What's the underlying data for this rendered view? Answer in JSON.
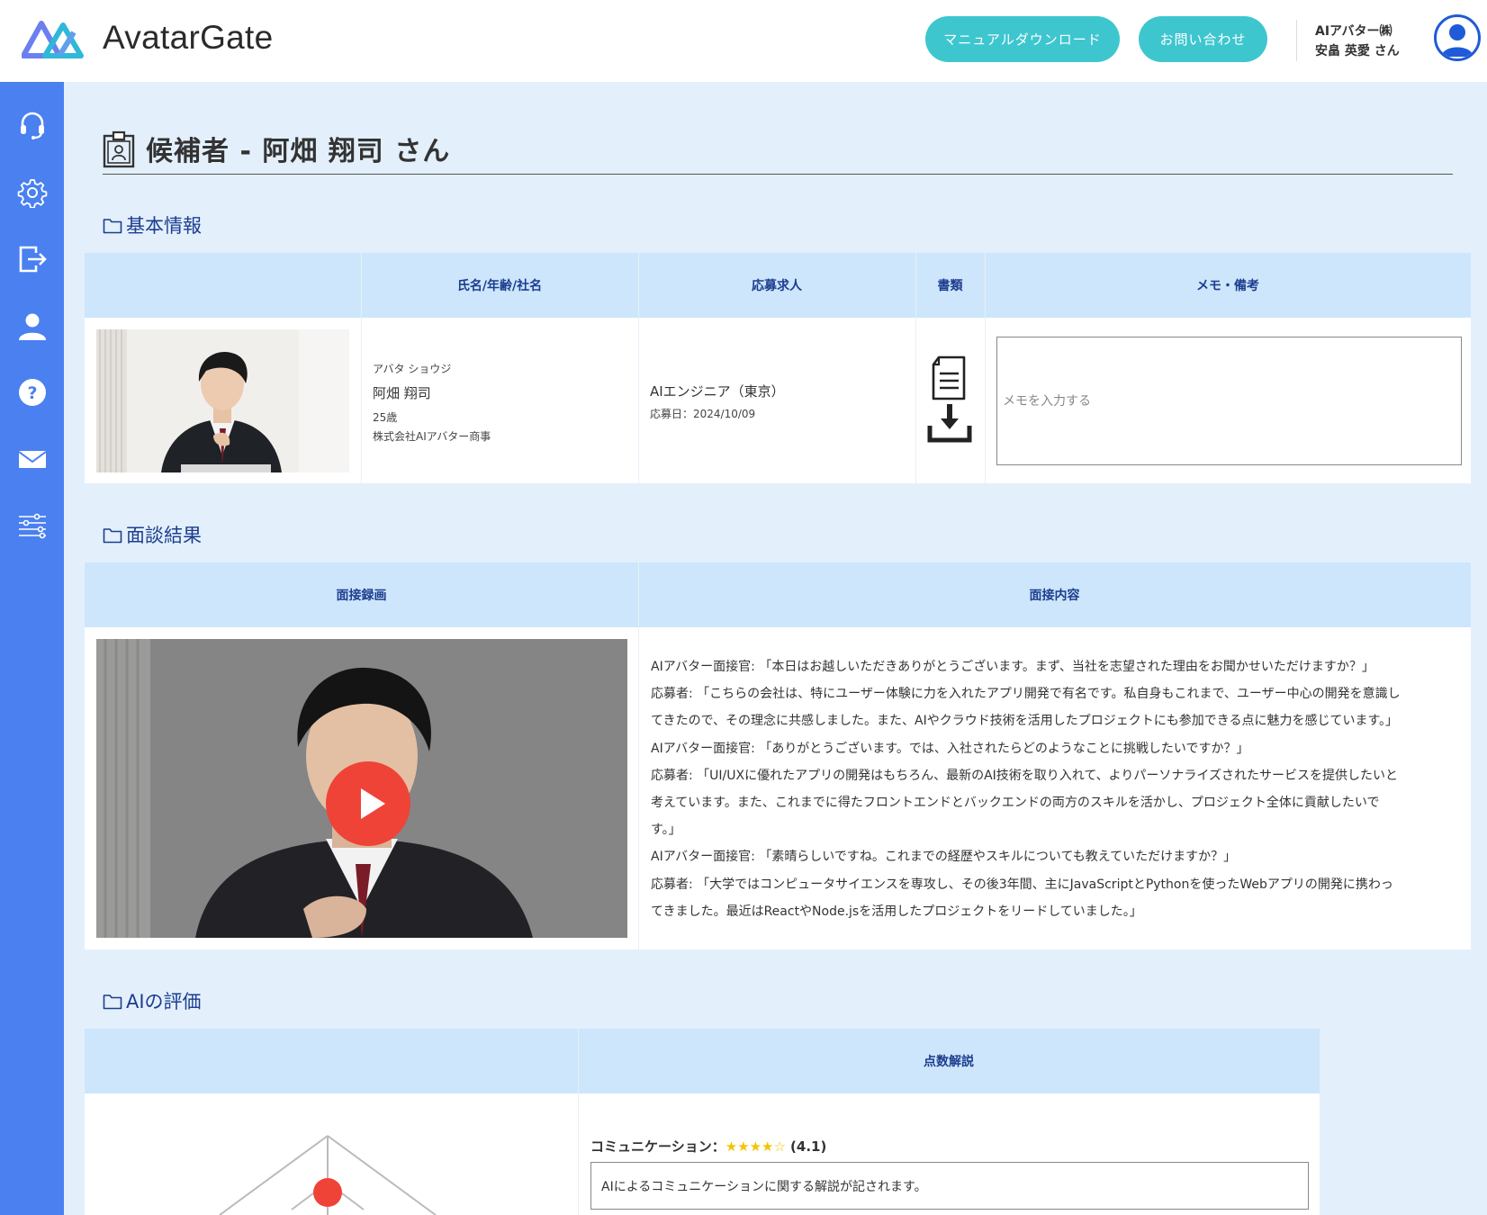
{
  "header": {
    "logo_text": "AvatarGate",
    "manual_button": "マニュアルダウンロード",
    "contact_button": "お問い合わせ",
    "user_company": "AIアバター㈱",
    "user_name": "安畠 英愛 さん"
  },
  "sidebar": {
    "items": [
      {
        "icon": "headset-icon"
      },
      {
        "icon": "gear-icon"
      },
      {
        "icon": "logout-icon"
      },
      {
        "icon": "user-icon"
      },
      {
        "icon": "help-icon"
      },
      {
        "icon": "mail-icon"
      },
      {
        "icon": "sliders-icon"
      }
    ]
  },
  "page": {
    "title": "候補者 - 阿畑 翔司 さん"
  },
  "basic_info": {
    "heading": "基本情報",
    "columns": [
      "",
      "氏名/年齢/社名",
      "応募求人",
      "書類",
      "メモ・備考"
    ],
    "candidate": {
      "kana": "アバタ ショウジ",
      "name": "阿畑 翔司",
      "age": "25歳",
      "company": "株式会社AIアバター商事"
    },
    "job": {
      "title": "AIエンジニア（東京）",
      "applied": "応募日：2024/10/09"
    },
    "memo_placeholder": "メモを入力する"
  },
  "interview": {
    "heading": "面談結果",
    "columns": [
      "面接録画",
      "面接内容"
    ],
    "transcript": [
      "AIアバター面接官: 「本日はお越しいただきありがとうございます。まず、当社を志望された理由をお聞かせいただけますか？」",
      "応募者: 「こちらの会社は、特にユーザー体験に力を入れたアプリ開発で有名です。私自身もこれまで、ユーザー中心の開発を意識し",
      "てきたので、その理念に共感しました。また、AIやクラウド技術を活用したプロジェクトにも参加できる点に魅力を感じています。」",
      "AIアバター面接官: 「ありがとうございます。では、入社されたらどのようなことに挑戦したいですか？」",
      "応募者: 「UI/UXに優れたアプリの開発はもちろん、最新のAI技術を取り入れて、よりパーソナライズされたサービスを提供したいと",
      "考えています。また、これまでに得たフロントエンドとバックエンドの両方のスキルを活かし、プロジェクト全体に貢献したいで",
      "す。」",
      "AIアバター面接官: 「素晴らしいですね。これまでの経歴やスキルについても教えていただけますか？」",
      "応募者: 「大学ではコンピュータサイエンスを専攻し、その後3年間、主にJavaScriptとPythonを使ったWebアプリの開発に携わっ",
      "てきました。最近はReactやNode.jsを活用したプロジェクトをリードしていました。」"
    ]
  },
  "ai_eval": {
    "heading": "AIの評価",
    "columns": [
      "",
      "点数解説"
    ],
    "items": [
      {
        "label": "コミュニケーション：",
        "stars": "★★★★☆",
        "score": "(4.1)",
        "rating": 4.1,
        "explanation": "AIによるコミュニケーションに関する解説が記されます。"
      }
    ]
  },
  "colors": {
    "sidebar": "#4a80f0",
    "accent_button": "#3ec6cf",
    "table_header": "#cde6fb",
    "page_background": "#e3f0fc",
    "heading_text": "#1d3d8f",
    "play_button": "#ef4338",
    "star": "#f5c300"
  }
}
